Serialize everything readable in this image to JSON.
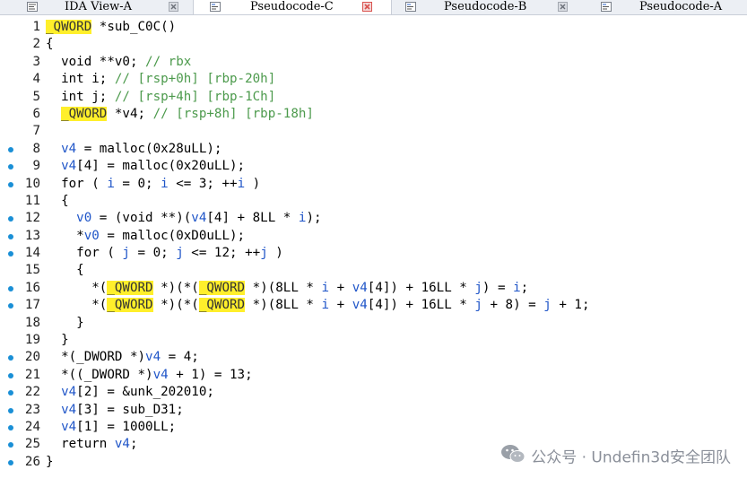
{
  "tabs": [
    {
      "label": "IDA View-A",
      "active": false,
      "icon": "disassembly-icon"
    },
    {
      "label": "Pseudocode-C",
      "active": true,
      "icon": "pseudocode-icon"
    },
    {
      "label": "Pseudocode-B",
      "active": false,
      "icon": "pseudocode-icon"
    },
    {
      "label": "Pseudocode-A",
      "active": false,
      "icon": "pseudocode-icon"
    }
  ],
  "colors": {
    "highlight": "#ffef2b",
    "breakpoint": "#1a8fd6",
    "comment": "#4c9a4c",
    "variable": "#1f55c8",
    "active_tab_close": "#d9534f"
  },
  "code": {
    "lines": [
      {
        "n": "1",
        "bp": false,
        "segs": [
          [
            "hl",
            "_QWORD"
          ],
          [
            "k",
            " *sub_C0C()"
          ]
        ]
      },
      {
        "n": "2",
        "bp": false,
        "segs": [
          [
            "k",
            "{"
          ]
        ]
      },
      {
        "n": "3",
        "bp": false,
        "segs": [
          [
            "k",
            "  void **v0; "
          ],
          [
            "c",
            "// rbx"
          ]
        ]
      },
      {
        "n": "4",
        "bp": false,
        "segs": [
          [
            "k",
            "  int i; "
          ],
          [
            "c",
            "// [rsp+0h] [rbp-20h]"
          ]
        ]
      },
      {
        "n": "5",
        "bp": false,
        "segs": [
          [
            "k",
            "  int j; "
          ],
          [
            "c",
            "// [rsp+4h] [rbp-1Ch]"
          ]
        ]
      },
      {
        "n": "6",
        "bp": false,
        "segs": [
          [
            "k",
            "  "
          ],
          [
            "hl",
            "_QWORD"
          ],
          [
            "k",
            " *v4; "
          ],
          [
            "c",
            "// [rsp+8h] [rbp-18h]"
          ]
        ]
      },
      {
        "n": "7",
        "bp": false,
        "segs": [
          [
            "k",
            ""
          ]
        ]
      },
      {
        "n": "8",
        "bp": true,
        "segs": [
          [
            "v",
            "  v4"
          ],
          [
            "k",
            " = malloc(0x28uLL);"
          ]
        ]
      },
      {
        "n": "9",
        "bp": true,
        "segs": [
          [
            "v",
            "  v4"
          ],
          [
            "k",
            "[4] = malloc(0x20uLL);"
          ]
        ]
      },
      {
        "n": "10",
        "bp": true,
        "segs": [
          [
            "k",
            "  for ( "
          ],
          [
            "v",
            "i"
          ],
          [
            "k",
            " = 0; "
          ],
          [
            "v",
            "i"
          ],
          [
            "k",
            " <= 3; ++"
          ],
          [
            "v",
            "i"
          ],
          [
            "k",
            " )"
          ]
        ]
      },
      {
        "n": "11",
        "bp": false,
        "segs": [
          [
            "k",
            "  {"
          ]
        ]
      },
      {
        "n": "12",
        "bp": true,
        "segs": [
          [
            "v",
            "    v0"
          ],
          [
            "k",
            " = (void **)("
          ],
          [
            "v",
            "v4"
          ],
          [
            "k",
            "[4] + 8LL * "
          ],
          [
            "v",
            "i"
          ],
          [
            "k",
            ");"
          ]
        ]
      },
      {
        "n": "13",
        "bp": true,
        "segs": [
          [
            "k",
            "    *"
          ],
          [
            "v",
            "v0"
          ],
          [
            "k",
            " = malloc(0xD0uLL);"
          ]
        ]
      },
      {
        "n": "14",
        "bp": true,
        "segs": [
          [
            "k",
            "    for ( "
          ],
          [
            "v",
            "j"
          ],
          [
            "k",
            " = 0; "
          ],
          [
            "v",
            "j"
          ],
          [
            "k",
            " <= 12; ++"
          ],
          [
            "v",
            "j"
          ],
          [
            "k",
            " )"
          ]
        ]
      },
      {
        "n": "15",
        "bp": false,
        "segs": [
          [
            "k",
            "    {"
          ]
        ]
      },
      {
        "n": "16",
        "bp": true,
        "segs": [
          [
            "k",
            "      *("
          ],
          [
            "hl",
            "_QWORD"
          ],
          [
            "k",
            " *)(*("
          ],
          [
            "hl",
            "_QWORD"
          ],
          [
            "k",
            " *)(8LL * "
          ],
          [
            "v",
            "i"
          ],
          [
            "k",
            " + "
          ],
          [
            "v",
            "v4"
          ],
          [
            "k",
            "[4]) + 16LL * "
          ],
          [
            "v",
            "j"
          ],
          [
            "k",
            ") = "
          ],
          [
            "v",
            "i"
          ],
          [
            "k",
            ";"
          ]
        ]
      },
      {
        "n": "17",
        "bp": true,
        "segs": [
          [
            "k",
            "      *("
          ],
          [
            "hl",
            "_QWORD"
          ],
          [
            "k",
            " *)(*("
          ],
          [
            "hl",
            "_QWORD"
          ],
          [
            "k",
            " *)(8LL * "
          ],
          [
            "v",
            "i"
          ],
          [
            "k",
            " + "
          ],
          [
            "v",
            "v4"
          ],
          [
            "k",
            "[4]) + 16LL * "
          ],
          [
            "v",
            "j"
          ],
          [
            "k",
            " + 8) = "
          ],
          [
            "v",
            "j"
          ],
          [
            "k",
            " + 1;"
          ]
        ]
      },
      {
        "n": "18",
        "bp": false,
        "segs": [
          [
            "k",
            "    }"
          ]
        ]
      },
      {
        "n": "19",
        "bp": false,
        "segs": [
          [
            "k",
            "  }"
          ]
        ]
      },
      {
        "n": "20",
        "bp": true,
        "segs": [
          [
            "k",
            "  *(_DWORD *)"
          ],
          [
            "v",
            "v4"
          ],
          [
            "k",
            " = 4;"
          ]
        ]
      },
      {
        "n": "21",
        "bp": true,
        "segs": [
          [
            "k",
            "  *((_DWORD *)"
          ],
          [
            "v",
            "v4"
          ],
          [
            "k",
            " + 1) = 13;"
          ]
        ]
      },
      {
        "n": "22",
        "bp": true,
        "segs": [
          [
            "v",
            "  v4"
          ],
          [
            "k",
            "[2] = &unk_202010;"
          ]
        ]
      },
      {
        "n": "23",
        "bp": true,
        "segs": [
          [
            "v",
            "  v4"
          ],
          [
            "k",
            "[3] = sub_D31;"
          ]
        ]
      },
      {
        "n": "24",
        "bp": true,
        "segs": [
          [
            "v",
            "  v4"
          ],
          [
            "k",
            "[1] = 1000LL;"
          ]
        ]
      },
      {
        "n": "25",
        "bp": true,
        "segs": [
          [
            "k",
            "  return "
          ],
          [
            "v",
            "v4"
          ],
          [
            "k",
            ";"
          ]
        ]
      },
      {
        "n": "26",
        "bp": true,
        "segs": [
          [
            "k",
            "}"
          ]
        ]
      }
    ]
  },
  "watermark": {
    "text": "公众号 · Undefin3d安全团队",
    "icon": "wechat-icon"
  }
}
